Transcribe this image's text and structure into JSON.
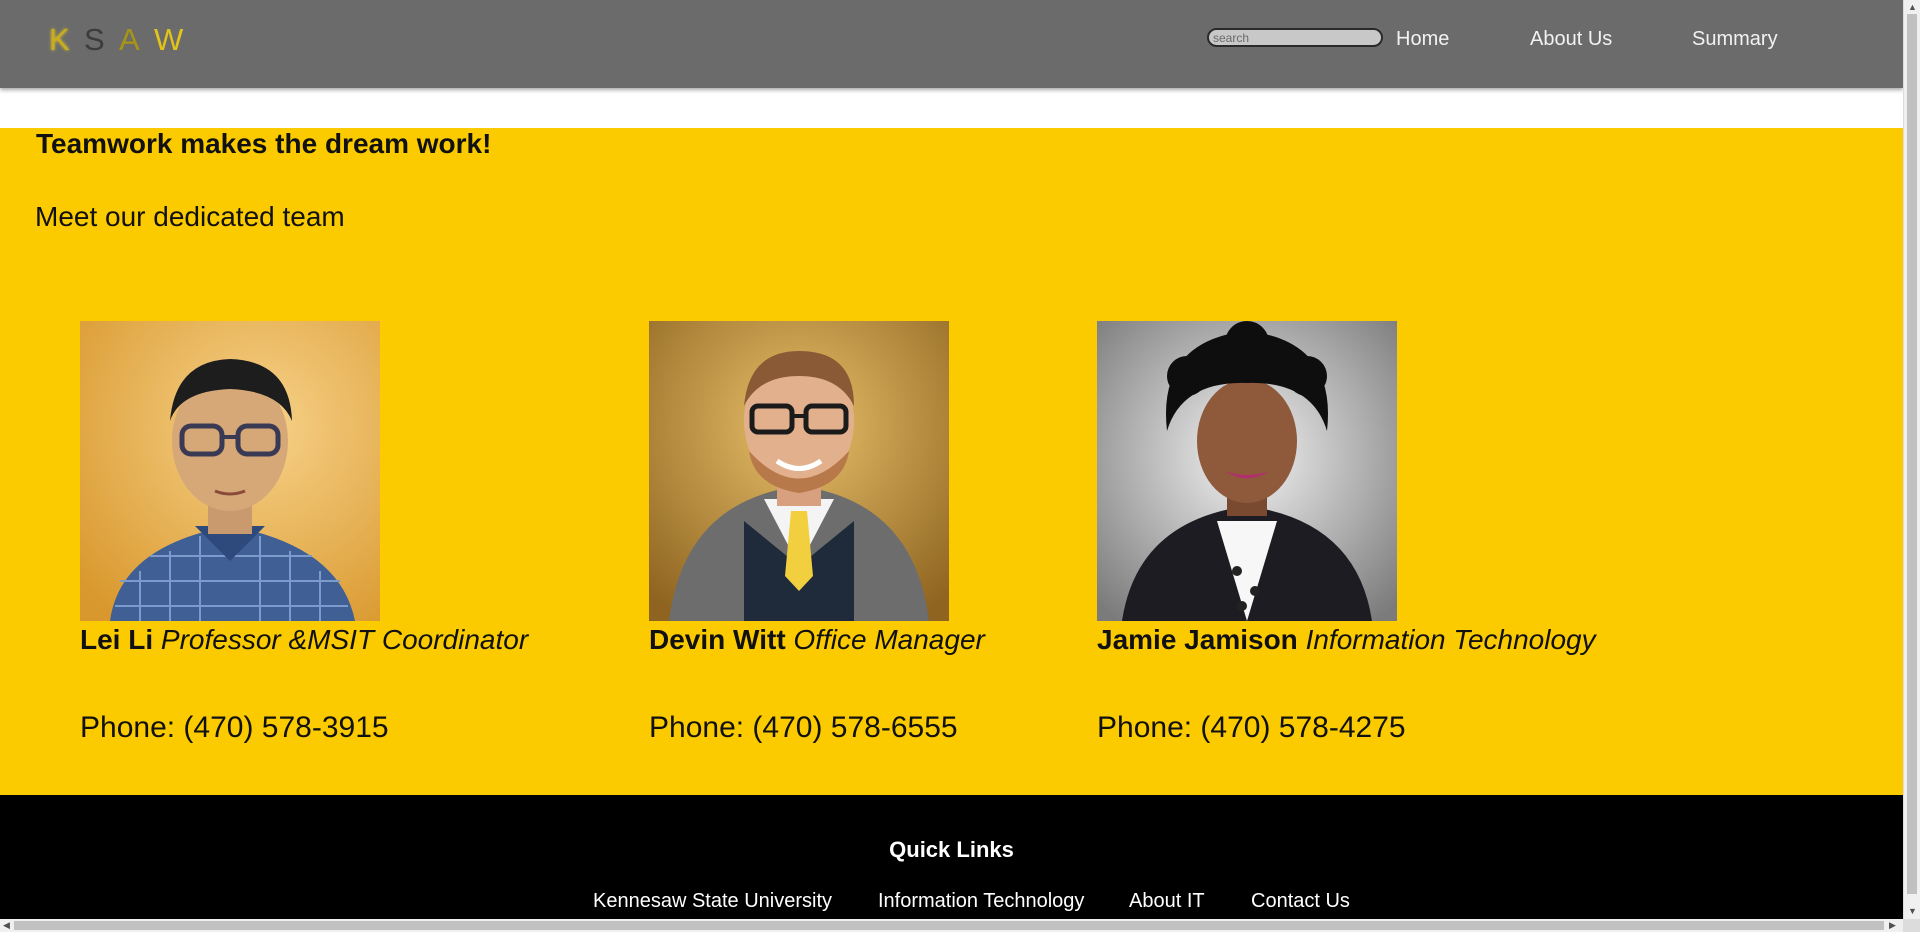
{
  "header": {
    "logo_letters": [
      "K",
      "S",
      "A",
      "W"
    ],
    "search_placeholder": "search",
    "nav": [
      "Home",
      "About Us",
      "Summary"
    ]
  },
  "main": {
    "title": "Teamwork makes the dream work!",
    "subtitle": "Meet our dedicated team",
    "team": [
      {
        "name": "Lei Li",
        "role": "Professor &MSIT Coordinator",
        "phone": "Phone: (470) 578-3915"
      },
      {
        "name": "Devin Witt",
        "role": "Office Manager",
        "phone": "Phone: (470) 578-6555"
      },
      {
        "name": "Jamie Jamison",
        "role": "Information Technology",
        "phone": "Phone: (470) 578-4275"
      }
    ]
  },
  "footer": {
    "heading": "Quick Links",
    "links": [
      "Kennesaw State University",
      "Information Technology",
      "About IT",
      "Contact Us"
    ]
  },
  "colors": {
    "header_bg": "#6b6b6b",
    "main_bg": "#fbcb00",
    "footer_bg": "#000000"
  }
}
